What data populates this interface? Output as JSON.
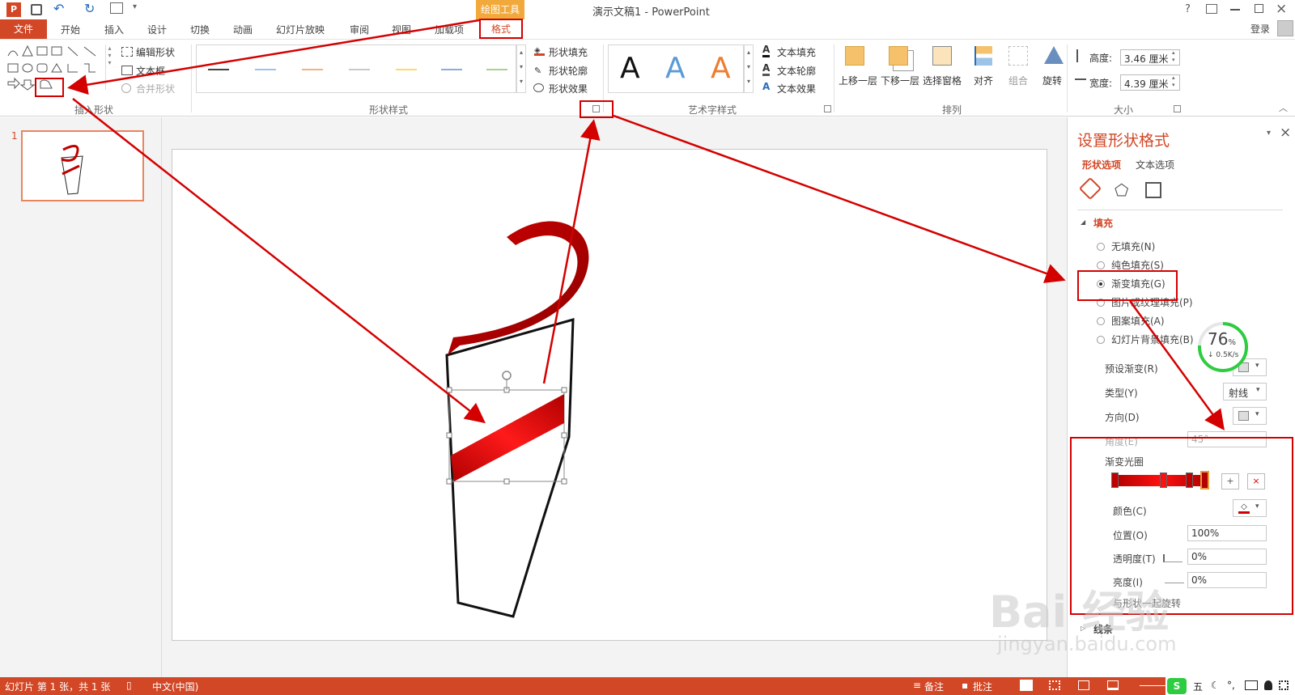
{
  "app": {
    "title": "演示文稿1 - PowerPoint",
    "contextual_tab": "绘图工具",
    "help_label": "?",
    "login_label": "登录"
  },
  "tabs": [
    "文件",
    "开始",
    "插入",
    "设计",
    "切换",
    "动画",
    "幻灯片放映",
    "审阅",
    "视图",
    "加载项",
    "格式"
  ],
  "ribbon": {
    "insert_shapes": {
      "edit_shape": "编辑形状",
      "text_box": "文本框",
      "merge_shapes": "合并形状",
      "group_label": "插入形状"
    },
    "shape_styles": {
      "fill": "形状填充",
      "outline": "形状轮廓",
      "effects": "形状效果",
      "group_label": "形状样式"
    },
    "wordart": {
      "sample": "A",
      "text_fill": "文本填充",
      "text_outline": "文本轮廓",
      "text_effects": "文本效果",
      "group_label": "艺术字样式"
    },
    "arrange": {
      "bring_forward": "上移一层",
      "send_backward": "下移一层",
      "selection_pane": "选择窗格",
      "align": "对齐",
      "group": "组合",
      "rotate": "旋转",
      "group_label": "排列"
    },
    "size": {
      "height_label": "高度:",
      "height_value": "3.46 厘米",
      "width_label": "宽度:",
      "width_value": "4.39 厘米",
      "group_label": "大小"
    }
  },
  "thumbnails": {
    "slide_number": "1"
  },
  "format_pane": {
    "title": "设置形状格式",
    "tab_shape": "形状选项",
    "tab_text": "文本选项",
    "section_fill": "填充",
    "options": [
      "无填充(N)",
      "纯色填充(S)",
      "渐变填充(G)",
      "图片或纹理填充(P)",
      "图案填充(A)",
      "幻灯片背景填充(B)"
    ],
    "selected_option": "渐变填充(G)",
    "preset_label": "预设渐变(R)",
    "type_label": "类型(Y)",
    "type_value": "射线",
    "direction_label": "方向(D)",
    "angle_label": "角度(E)",
    "angle_value": "45°",
    "stops_label": "渐变光圈",
    "color_label": "颜色(C)",
    "position_label": "位置(O)",
    "position_value": "100%",
    "transparency_label": "透明度(T)",
    "transparency_value": "0%",
    "brightness_label": "亮度(I)",
    "brightness_value": "0%",
    "rotate_with_shape": "与形状一起旋转",
    "section_line": "线条"
  },
  "network_widget": {
    "percent": "76",
    "percent_sign": "%",
    "speed": "0.5K/s",
    "ring_fraction": 0.76
  },
  "status": {
    "slide_info": "幻灯片 第 1 张，共 1 张",
    "language": "中文(中国)",
    "notes": "备注",
    "comments": "批注"
  },
  "watermark": {
    "brand": "Bai 经验",
    "url": "jingyan.baidu.com"
  },
  "colors": {
    "accent": "#d24726",
    "contextual": "#f2a93b",
    "annotation": "#d40000",
    "shape_red": "#c00000",
    "wordart_blue": "#5b9bd5",
    "wordart_orange": "#ed7d31",
    "ring_green": "#2ecc40"
  }
}
